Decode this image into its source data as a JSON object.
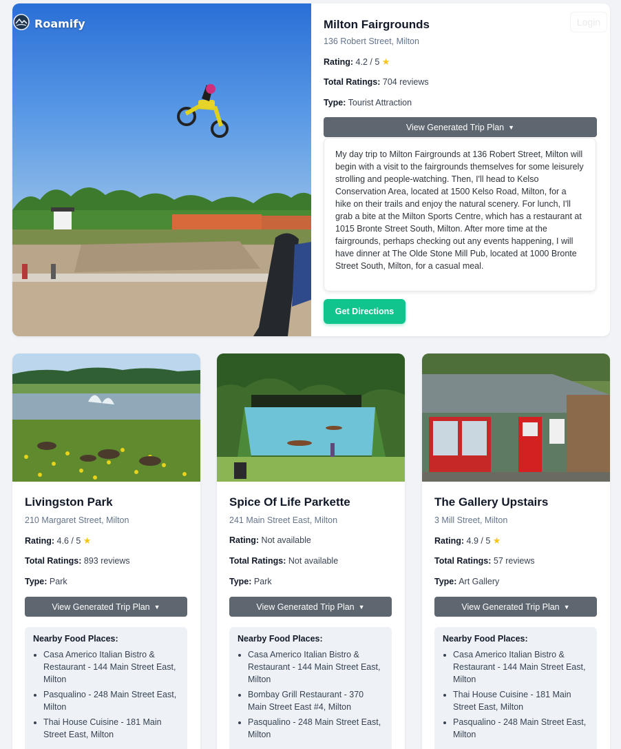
{
  "brand": {
    "name": "Roamify"
  },
  "header": {
    "login_label": "Login"
  },
  "featured": {
    "name": "Milton Fairgrounds",
    "address": "136 Robert Street, Milton",
    "rating_label": "Rating:",
    "rating": "4.2 / 5",
    "total_label": "Total Ratings:",
    "total": "704 reviews",
    "type_label": "Type:",
    "type": "Tourist Attraction",
    "trip_button": "View Generated Trip Plan",
    "trip_plan": "My day trip to Milton Fairgrounds at 136 Robert Street, Milton will begin with a visit to the fairgrounds themselves for some leisurely strolling and people-watching.  Then, I'll head to Kelso Conservation Area, located at 1500 Kelso Road, Milton, for a hike on their trails and enjoy the natural scenery.  For lunch, I'll grab a bite at the Milton Sports Centre, which has a restaurant at 1015 Bronte Street South, Milton.  After more time at the fairgrounds, perhaps checking out any events happening, I will have dinner at The Olde Stone Mill Pub, located at 1000 Bronte Street South, Milton, for a casual meal.",
    "directions_button": "Get Directions"
  },
  "cards": [
    {
      "name": "Livingston Park",
      "address": "210 Margaret Street, Milton",
      "rating_label": "Rating:",
      "rating": "4.6 / 5",
      "total_label": "Total Ratings:",
      "total": "893 reviews",
      "type_label": "Type:",
      "type": "Park",
      "trip_button": "View Generated Trip Plan",
      "food_heading": "Nearby Food Places:",
      "food": [
        "Casa Americo Italian Bistro & Restaurant - 144 Main Street East, Milton",
        "Pasqualino - 248 Main Street East, Milton",
        "Thai House Cuisine - 181 Main Street East, Milton"
      ]
    },
    {
      "name": "Spice Of Life Parkette",
      "address": "241 Main Street East, Milton",
      "rating_label": "Rating:",
      "rating": "Not available",
      "total_label": "Total Ratings:",
      "total": "Not available",
      "type_label": "Type:",
      "type": "Park",
      "trip_button": "View Generated Trip Plan",
      "food_heading": "Nearby Food Places:",
      "food": [
        "Casa Americo Italian Bistro & Restaurant - 144 Main Street East, Milton",
        "Bombay Grill Restaurant - 370 Main Street East #4, Milton",
        "Pasqualino - 248 Main Street East, Milton"
      ]
    },
    {
      "name": "The Gallery Upstairs",
      "address": "3 Mill Street, Milton",
      "rating_label": "Rating:",
      "rating": "4.9 / 5",
      "total_label": "Total Ratings:",
      "total": "57 reviews",
      "type_label": "Type:",
      "type": "Art Gallery",
      "trip_button": "View Generated Trip Plan",
      "food_heading": "Nearby Food Places:",
      "food": [
        "Casa Americo Italian Bistro & Restaurant - 144 Main Street East, Milton",
        "Thai House Cuisine - 181 Main Street East, Milton",
        "Pasqualino - 248 Main Street East, Milton"
      ]
    }
  ]
}
